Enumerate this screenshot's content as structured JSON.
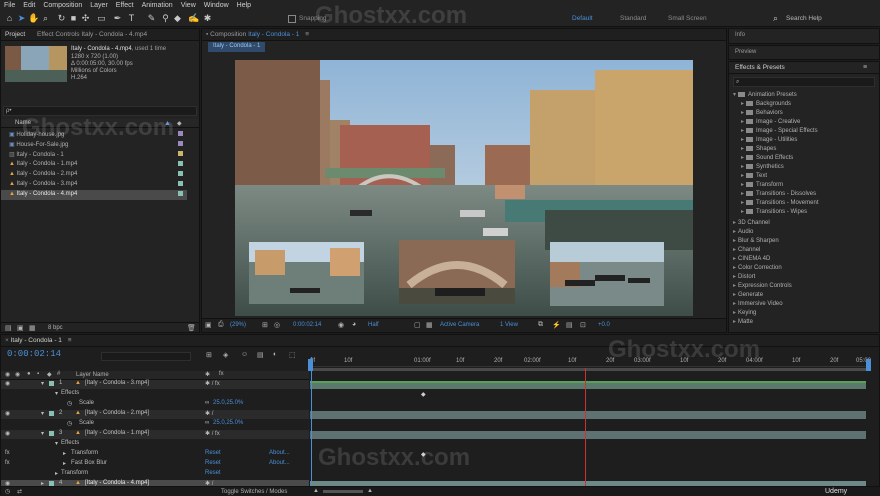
{
  "menu": [
    "File",
    "Edit",
    "Composition",
    "Layer",
    "Effect",
    "Animation",
    "View",
    "Window",
    "Help"
  ],
  "toolbar": {
    "snapping": "Snapping",
    "workspaces": [
      "Default",
      "Standard",
      "Small Screen"
    ],
    "search_placeholder": "Search Help"
  },
  "project": {
    "tab": "Project",
    "effect_controls_tab": "Effect Controls Italy - Condola - 4.mp4",
    "item_name": "Italy - Condola - 4.mp4",
    "used": ", used 1 time",
    "dimensions": "1280 x 720 (1.00)",
    "duration": "Δ 0:00:05:00, 30.00 fps",
    "colors": "Millions of Colors",
    "codec": "H.264",
    "search_placeholder": "ρ•",
    "column_name": "Name",
    "files": [
      "Holiday-house.jpg",
      "House-For-Sale.jpg",
      "Italy - Condola - 1",
      "Italy - Condola - 1.mp4",
      "Italy - Condola - 2.mp4",
      "Italy - Condola - 3.mp4",
      "Italy - Condola - 4.mp4"
    ],
    "bpc": "8 bpc"
  },
  "composition": {
    "tab": "Composition",
    "tab_name": "Italy - Condola - 1",
    "sub_tab": "Italy - Condola - 1",
    "zoom": "(29%)",
    "timecode": "0:00:02:14",
    "resolution": "Half",
    "camera": "Active Camera",
    "view": "1 View",
    "offset": "+0.0"
  },
  "right": {
    "info": "Info",
    "preview": "Preview",
    "effects_title": "Effects & Presets",
    "animation_presets": "Animation Presets",
    "presets": [
      "Backgrounds",
      "Behaviors",
      "Image - Creative",
      "Image - Special Effects",
      "Image - Utilities",
      "Shapes",
      "Sound Effects",
      "Synthetics",
      "Text",
      "Transform",
      "Transitions - Dissolves",
      "Transitions - Movement",
      "Transitions - Wipes"
    ],
    "categories": [
      "3D Channel",
      "Audio",
      "Blur & Sharpen",
      "Channel",
      "CINEMA 4D",
      "Color Correction",
      "Distort",
      "Expression Controls",
      "Generate",
      "Immersive Video",
      "Keying",
      "Matte"
    ]
  },
  "timeline": {
    "tab": "Italy - Condola - 1",
    "timecode": "0:00:02:14",
    "column_layer_name": "Layer Name",
    "ruler": [
      "0f",
      "10f",
      "01:00f",
      "10f",
      "20f",
      "02:00f",
      "10f",
      "20f",
      "03:00f",
      "10f",
      "20f",
      "04:00f",
      "10f",
      "20f",
      "05:00"
    ],
    "rows": [
      {
        "num": "1",
        "name": "[Italy - Condola - 3.mp4]",
        "kind": "layer"
      },
      {
        "name": "Effects",
        "kind": "group"
      },
      {
        "name": "Scale",
        "value": "25.0,25.0%",
        "kind": "prop"
      },
      {
        "num": "2",
        "name": "[Italy - Condola - 2.mp4]",
        "kind": "layer"
      },
      {
        "name": "Scale",
        "value": "25.0,25.0%",
        "kind": "prop"
      },
      {
        "num": "3",
        "name": "[Italy - Condola - 1.mp4]",
        "kind": "layer"
      },
      {
        "name": "Effects",
        "kind": "group"
      },
      {
        "name": "Transform",
        "reset": "Reset",
        "about": "About...",
        "kind": "fx"
      },
      {
        "name": "Fast Box Blur",
        "reset": "Reset",
        "about": "About...",
        "kind": "fx"
      },
      {
        "name": "Transform",
        "reset": "Reset",
        "kind": "group"
      },
      {
        "num": "4",
        "name": "[Italy - Condola - 4.mp4]",
        "kind": "layer"
      }
    ],
    "toggle": "Toggle Switches / Modes"
  },
  "watermark": "Ghostxx.com",
  "udemy": "Udemy"
}
